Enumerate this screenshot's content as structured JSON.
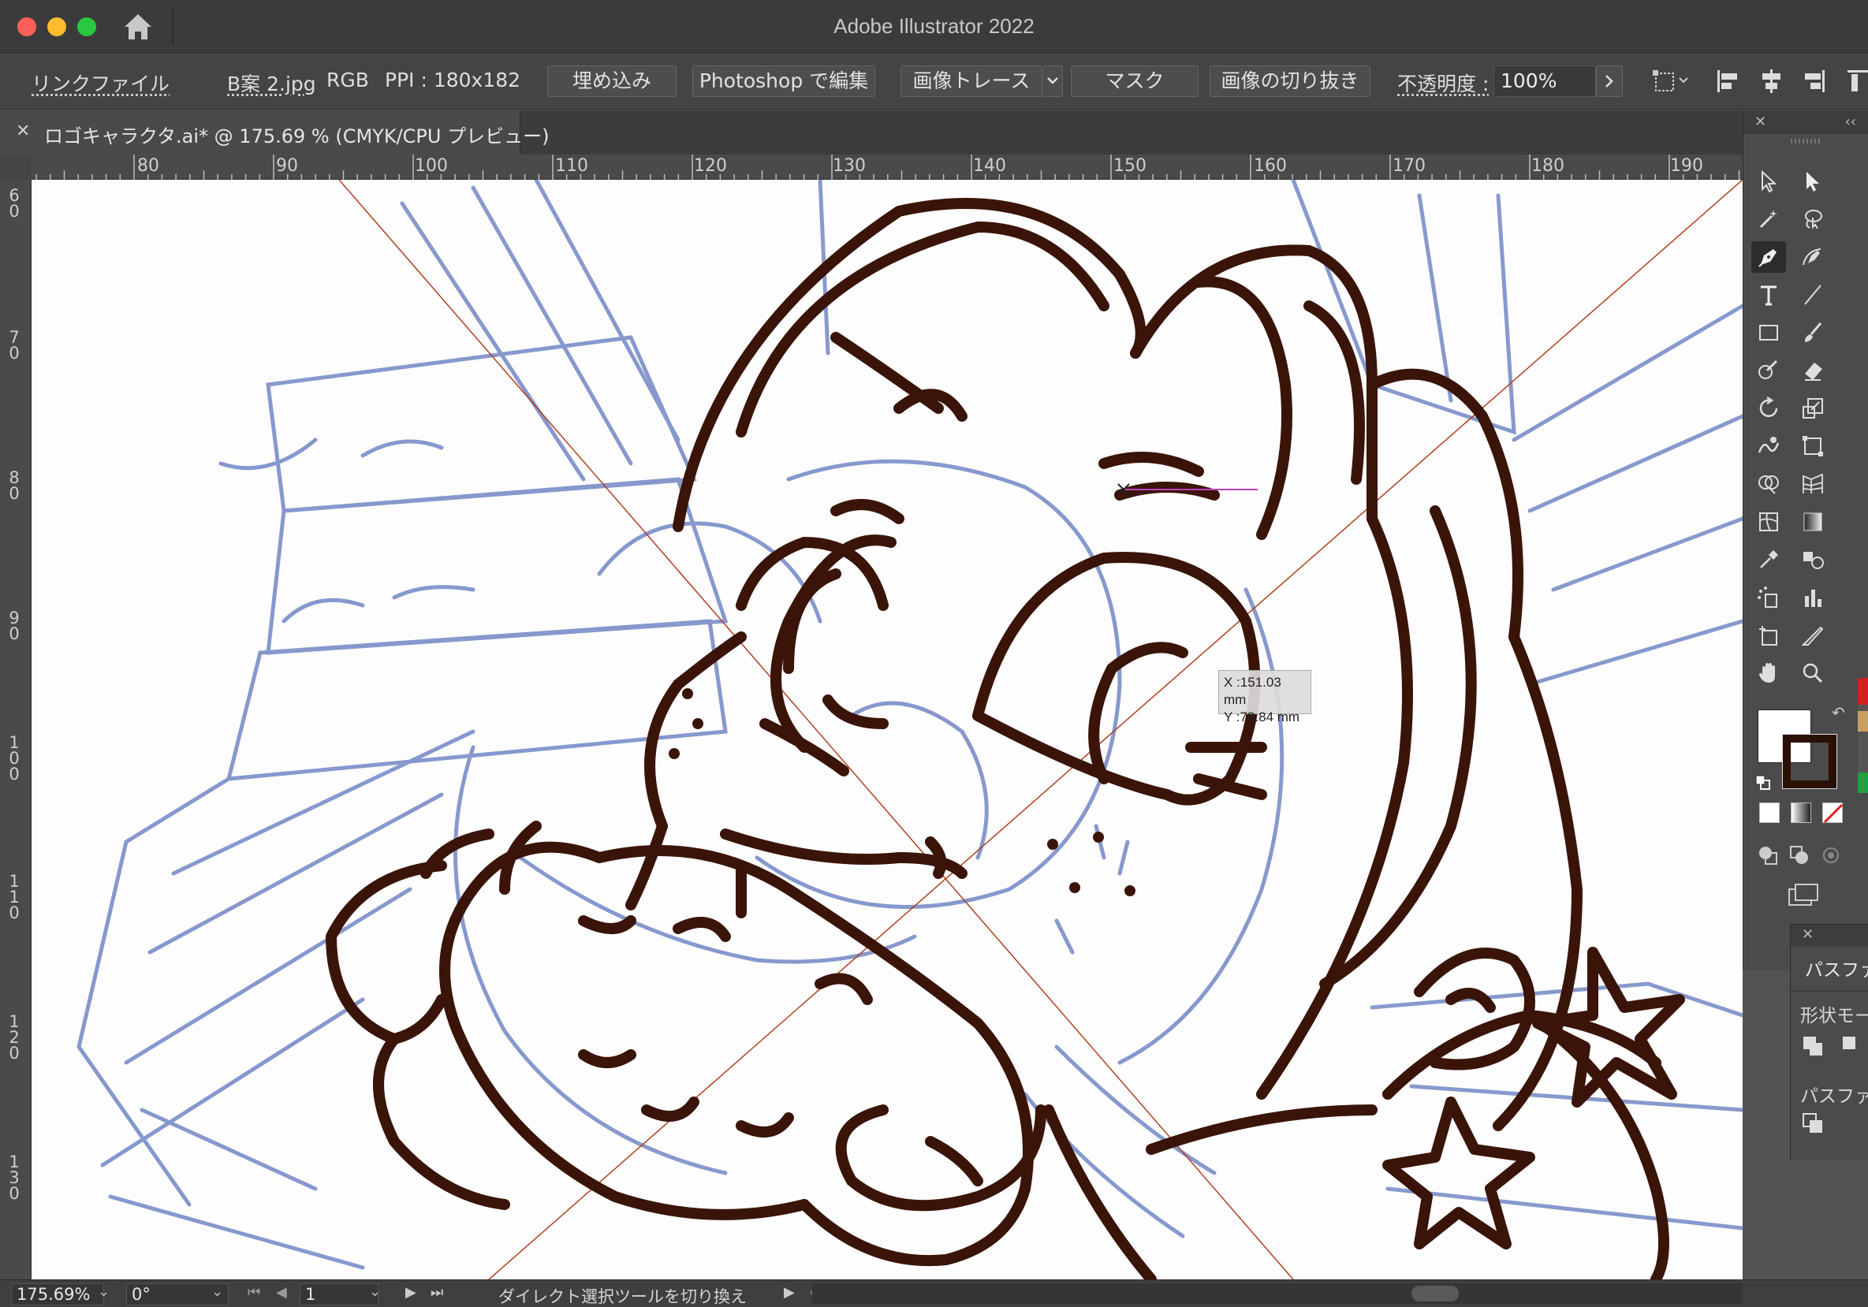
{
  "window": {
    "title": "Adobe Illustrator 2022"
  },
  "controlbar": {
    "link_file": "リンクファイル",
    "filename": "B案 2.jpg",
    "color_mode": "RGB",
    "ppi": "PPI : 180x182",
    "embed_label": "埋め込み",
    "photoshop_label": "Photoshop で編集",
    "image_trace_label": "画像トレース",
    "mask_label": "マスク",
    "crop_label": "画像の切り抜き",
    "opacity_label": "不透明度 :",
    "opacity_value": "100%"
  },
  "document": {
    "tab_title": "ロゴキャラクタ.ai* @ 175.69 % (CMYK/CPU プレビュー)"
  },
  "rulers": {
    "horizontal": [
      "80",
      "90",
      "100",
      "110",
      "120",
      "130",
      "140",
      "150",
      "160",
      "170",
      "180",
      "190"
    ],
    "vertical": [
      "60",
      "70",
      "80",
      "90",
      "100",
      "110",
      "120",
      "130"
    ]
  },
  "canvas": {
    "cursor_readout_x": "X :151.03 mm",
    "cursor_readout_y": "Y :78.84 mm",
    "stroke_color": "#3a1408",
    "sketch_color": "#7a8ec8",
    "guide_color": "#b24020"
  },
  "tools": {
    "items": [
      "direct-selection",
      "selection",
      "magic-wand",
      "lasso",
      "pen",
      "curvature",
      "type",
      "line-segment",
      "rectangle",
      "paintbrush",
      "shaper",
      "eraser",
      "rotate",
      "scale",
      "warp",
      "free-transform",
      "shape-builder",
      "perspective-grid",
      "mesh",
      "gradient",
      "eyedropper",
      "blend",
      "symbol-sprayer",
      "column-graph",
      "artboard",
      "slice",
      "hand",
      "zoom"
    ],
    "active": "pen",
    "fill_color": "#ffffff",
    "stroke_color": "#2a1006"
  },
  "pathfinder": {
    "title": "パスファ",
    "shape_modes_label": "形状モー",
    "pathfinders_label": "パスファ"
  },
  "statusbar": {
    "zoom": "175.69%",
    "rotation": "0°",
    "artboard": "1",
    "message": "ダイレクト選択ツールを切り換え"
  }
}
